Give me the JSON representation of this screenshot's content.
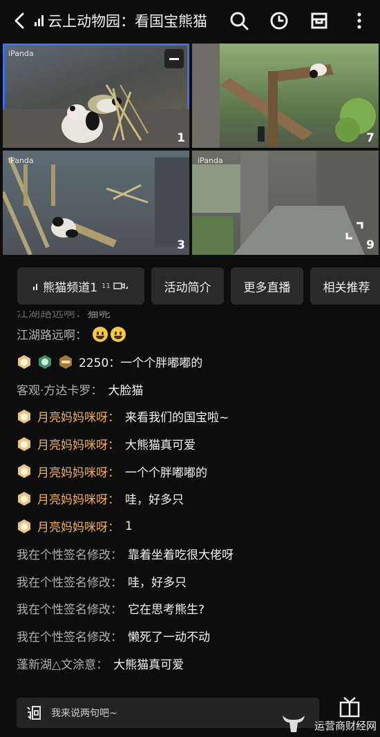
{
  "header": {
    "title": "云上动物园：看国宝熊猫",
    "icons": [
      "back-arrow-icon",
      "search-icon",
      "history-clock-icon",
      "inbox-icon",
      "more-icon"
    ]
  },
  "cameras": [
    {
      "watermark": "iPanda",
      "number": "1",
      "selected": true
    },
    {
      "watermark": "",
      "number": "7",
      "selected": false
    },
    {
      "watermark": "iPanda",
      "number": "3",
      "selected": false
    },
    {
      "watermark": "iPanda",
      "number": "9",
      "selected": false
    }
  ],
  "tabs": [
    {
      "label": "熊猫频道1",
      "sub": "11"
    },
    {
      "label": "活动简介"
    },
    {
      "label": "更多直播"
    },
    {
      "label": "相关推荐"
    }
  ],
  "chat": {
    "truncated": {
      "user": "江湖路远啊：",
      "text": "猫呢"
    },
    "messages": [
      {
        "user": "江湖路远啊",
        "text": "",
        "emoji": true,
        "vip": false,
        "badges": []
      },
      {
        "user": "",
        "text": "2250：一个个胖嘟嘟的",
        "emoji": false,
        "vip": false,
        "badges": [
          "hexagon-badge",
          "green-badge",
          "gold-badge"
        ]
      },
      {
        "user": "客观·方达卡罗",
        "text": "大脸猫",
        "emoji": false,
        "vip": false,
        "badges": []
      },
      {
        "user": "月亮妈妈咪呀",
        "text": "来看我们的国宝啦~",
        "vip": true,
        "badges": [
          "hexagon-badge"
        ]
      },
      {
        "user": "月亮妈妈咪呀",
        "text": "大熊猫真可爱",
        "vip": true,
        "badges": [
          "hexagon-badge"
        ]
      },
      {
        "user": "月亮妈妈咪呀",
        "text": "一个个胖嘟嘟的",
        "vip": true,
        "badges": [
          "hexagon-badge"
        ]
      },
      {
        "user": "月亮妈妈咪呀",
        "text": "哇，好多只",
        "vip": true,
        "badges": [
          "hexagon-badge"
        ]
      },
      {
        "user": "月亮妈妈咪呀",
        "text": "1",
        "vip": true,
        "badges": [
          "hexagon-badge"
        ]
      },
      {
        "user": "我在个性签名修改",
        "text": "靠着坐着吃很大佬呀",
        "vip": false,
        "badges": []
      },
      {
        "user": "我在个性签名修改",
        "text": "哇，好多只",
        "vip": false,
        "badges": []
      },
      {
        "user": "我在个性签名修改",
        "text": "它在思考熊生?",
        "vip": false,
        "badges": []
      },
      {
        "user": "我在个性签名修改",
        "text": "懒死了一动不动",
        "vip": false,
        "badges": []
      },
      {
        "user": "蓬新湖△文涂意",
        "text": "大熊猫真可爱",
        "vip": false,
        "badges": []
      }
    ]
  },
  "input": {
    "placeholder": "我来说两句吧~",
    "icon": "word-icon"
  },
  "watermark_logo": "运营商财经网",
  "colors": {
    "accent": "#3a6ff7",
    "vip": "#f0b05a",
    "background": "#0d0d0d"
  }
}
